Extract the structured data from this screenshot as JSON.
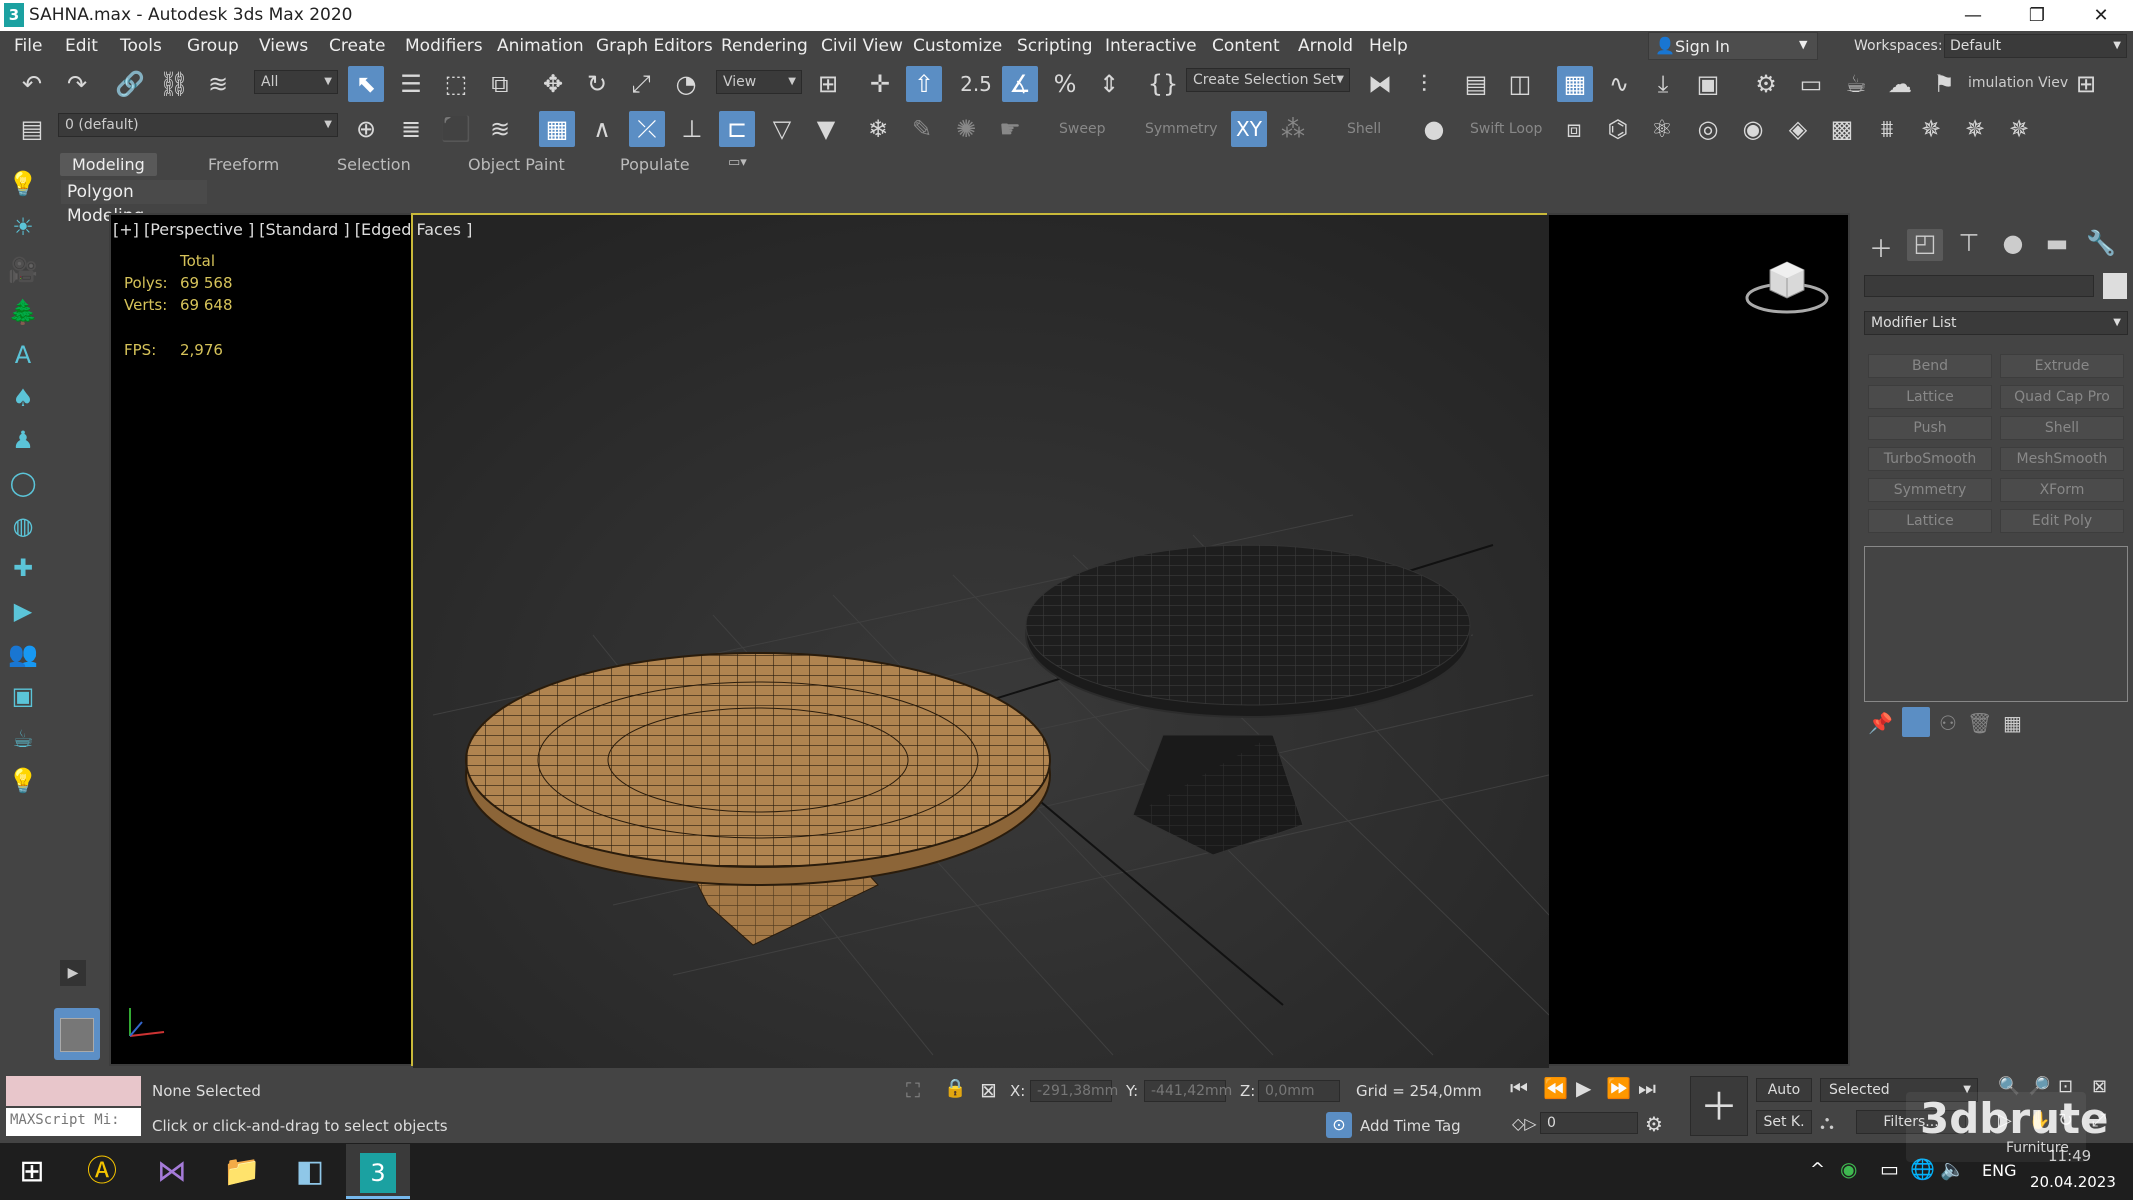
{
  "window": {
    "title": "SAHNA.max - Autodesk 3ds Max 2020",
    "app_icon": "3",
    "minimize": "—",
    "maximize": "❐",
    "close": "✕"
  },
  "menu": {
    "items": [
      "File",
      "Edit",
      "Tools",
      "Group",
      "Views",
      "Create",
      "Modifiers",
      "Animation",
      "Graph Editors",
      "Rendering",
      "Civil View",
      "Customize",
      "Scripting",
      "Interactive",
      "Content",
      "Arnold",
      "Help"
    ]
  },
  "account": {
    "sign_in": "Sign In",
    "workspaces_label": "Workspaces:",
    "workspace": "Default"
  },
  "toolbar": {
    "filter": "All",
    "ref_coord": "View",
    "selection_set": "Create Selection Set",
    "sim_label": "imulation Viev",
    "layer": "0 (default)",
    "sweep": "Sweep",
    "symmetry": "Symmetry",
    "shell": "Shell",
    "swift_loop": "Swift Loop",
    "snap_25": "2.5"
  },
  "ribbon": {
    "tabs": [
      "Modeling",
      "Freeform",
      "Selection",
      "Object Paint",
      "Populate"
    ],
    "active": "Modeling",
    "panel": "Polygon Modeling"
  },
  "viewport": {
    "label": "[+] [Perspective ] [Standard ] [Edged Faces ]",
    "stats": {
      "total": "Total",
      "polys_label": "Polys:",
      "polys": "69 568",
      "verts_label": "Verts:",
      "verts": "69 648",
      "fps_label": "FPS:",
      "fps": "2,976"
    },
    "colors": {
      "table1": "#b08450",
      "table2": "#1e1e1e",
      "border_active": "#c9b93a"
    }
  },
  "command_panel": {
    "modifier_list": "Modifier List",
    "buttons": [
      "Bend",
      "Extrude",
      "Lattice",
      "Quad Cap Pro",
      "Push",
      "Shell",
      "TurboSmooth",
      "MeshSmooth",
      "Symmetry",
      "XForm",
      "Lattice",
      "Edit Poly"
    ]
  },
  "status": {
    "script_label": "MAXScript Mi:",
    "none_selected": "None Selected",
    "prompt": "Click or click-and-drag to select objects",
    "x_label": "X:",
    "x": "-291,38mm",
    "y_label": "Y:",
    "y": "-441,42mm",
    "z_label": "Z:",
    "z": "0,0mm",
    "grid": "Grid = 254,0mm",
    "add_time_tag": "Add Time Tag",
    "frame": "0",
    "auto": "Auto",
    "selected": "Selected",
    "set_key": "Set K.",
    "filters": "Filters..."
  },
  "taskbar": {
    "lang": "ENG",
    "time": "11:49",
    "date": "20.04.2023",
    "watermark": "3dbrute",
    "watermark_sub": "Furniture"
  }
}
